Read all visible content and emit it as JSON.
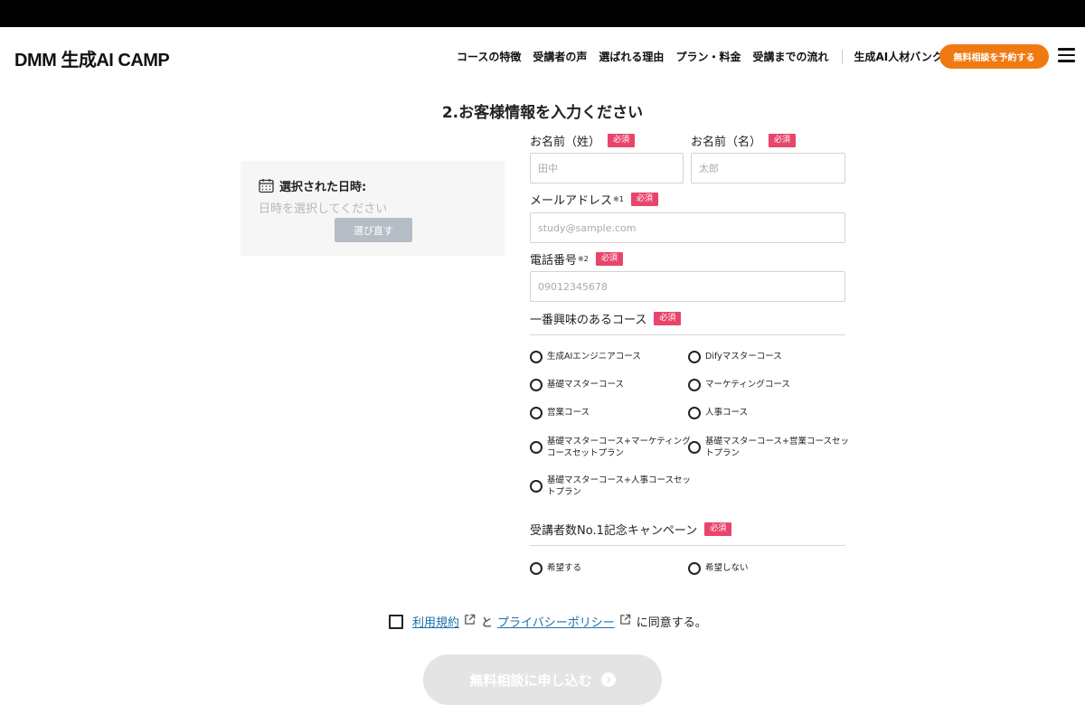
{
  "header": {
    "logo": "DMM 生成AI CAMP",
    "nav": [
      "コースの特徴",
      "受講者の声",
      "選ばれる理由",
      "プラン・料金",
      "受講までの流れ"
    ],
    "external_link": "生成AI人材バンク",
    "cta": "無料相談を予約する",
    "menu_icon": "hamburger-icon"
  },
  "form": {
    "title": "2.お客様情報を入力ください",
    "required_badge": "必須",
    "last_name": {
      "label": "お名前（姓）",
      "placeholder": "田中"
    },
    "first_name": {
      "label": "お名前（名）",
      "placeholder": "太郎"
    },
    "email": {
      "label": "メールアドレス",
      "note": "※1",
      "placeholder": "study@sample.com"
    },
    "phone": {
      "label": "電話番号",
      "note": "※2",
      "placeholder": "09012345678"
    },
    "course": {
      "label": "一番興味のあるコース",
      "options": [
        "生成AIエンジニアコース",
        "Difyマスターコース",
        "基礎マスターコース",
        "マーケティングコース",
        "営業コース",
        "人事コース",
        "基礎マスターコース+マーケティングコースセットプラン",
        "基礎マスターコース+営業コースセットプラン",
        "基礎マスターコース+人事コースセットプラン"
      ]
    },
    "campaign": {
      "label": "受講者数No.1記念キャンペーン",
      "options": [
        "希望する",
        "希望しない"
      ]
    },
    "agree": {
      "terms": "利用規約",
      "and": "と",
      "privacy": "プライバシーポリシー",
      "suffix": "に同意する。"
    },
    "submit": "無料相談に申し込む"
  },
  "datetime": {
    "heading": "選択された日時:",
    "placeholder": "日時を選択してください",
    "reselect": "選び直す",
    "icon": "calendar-icon"
  },
  "colors": {
    "accent_orange": "#f07a12",
    "required_pink": "#e8456b",
    "link_blue": "#1a6fa8",
    "disabled_gray": "#e4e4e4"
  }
}
